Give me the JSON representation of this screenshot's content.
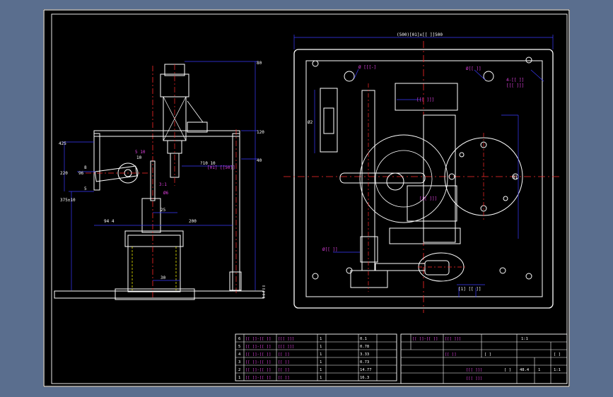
{
  "colors": {
    "viewer_bg": "#5a6e8e",
    "sheet_bg": "#000000",
    "outline": "#ffffff",
    "dimension": "#3b3bff",
    "centerline": "#ff2a2a",
    "label": "#e040e0",
    "hidden": "#e8e800"
  },
  "side_view": {
    "dims": {
      "right_top": "80",
      "right_mid": "120",
      "right_low": "40",
      "left_top": "425",
      "left_mid": "220",
      "left_low": "375±10",
      "arm_small": "8",
      "arm_small2": "5",
      "center_box": "?10 10",
      "horizontal_mid": "25",
      "horizontal_low": "200",
      "bottom_width": "30",
      "arm_left": "94 4",
      "left_x": "96",
      "right_side_note": "10"
    },
    "labels": {
      "arm_note": "5 10",
      "arm_note2": "3:1",
      "center_hole": "[01] [[50]]",
      "cylinder_top": "Ø6"
    }
  },
  "plan_view": {
    "dims": {
      "top_overall": "(500)[01]x[[ ]]500",
      "right_circle": "Ø1",
      "left_vertical": "Ø2",
      "bottom_small": "[1] [[ ]]"
    },
    "labels": {
      "plate_top_left": "Ø [[[-]",
      "plate_top_right": "Ø[[ ]]",
      "corner_note_line1": "4-[[ ]]",
      "corner_note_line2": "[[[ ]]]",
      "center_box": "[[[ ]]]",
      "pivot": "[[[ ]]]",
      "bottom_left_tag": "Ø[[ ]]"
    }
  },
  "parts_table": {
    "rows": [
      {
        "no": "6",
        "code": "[[ ]]-[[ ]]",
        "name": "[[[ ]]]",
        "qty": "1",
        "weight": "0.1",
        "note": ""
      },
      {
        "no": "5",
        "code": "[[ ]]-[[ ]]",
        "name": "[[[ ]]]",
        "qty": "1",
        "weight": "0.78",
        "note": ""
      },
      {
        "no": "4",
        "code": "[[ ]]-[[ ]]",
        "name": "[[ ]]",
        "qty": "1",
        "weight": "3.33",
        "note": ""
      },
      {
        "no": "3",
        "code": "[[ ]]-[[ ]]",
        "name": "[[ ]]",
        "qty": "1",
        "weight": "0.73",
        "note": ""
      },
      {
        "no": "2",
        "code": "[[ ]]-[[ ]]",
        "name": "[[ ]]",
        "qty": "1",
        "weight": "14.77",
        "note": ""
      },
      {
        "no": "1",
        "code": "[[ ]]-[[ ]]",
        "name": "[[ ]]",
        "qty": "1",
        "weight": "16.3",
        "note": ""
      }
    ]
  },
  "title_block": {
    "top_row": {
      "code": "[[ ]]-[[ ]]",
      "name": "[[[ ]]]",
      "scale_label": "1:1"
    },
    "row2": {
      "mid": "[[ ]]",
      "right1": "[ ]",
      "right2": "[ ]"
    },
    "title_main": "[[[ ]]]",
    "title_sub": "[[[ ]]]",
    "sheet_a": "[ ]",
    "sheet_b": "48.4",
    "sheet_c": "1",
    "sheet_d": "1:1"
  }
}
